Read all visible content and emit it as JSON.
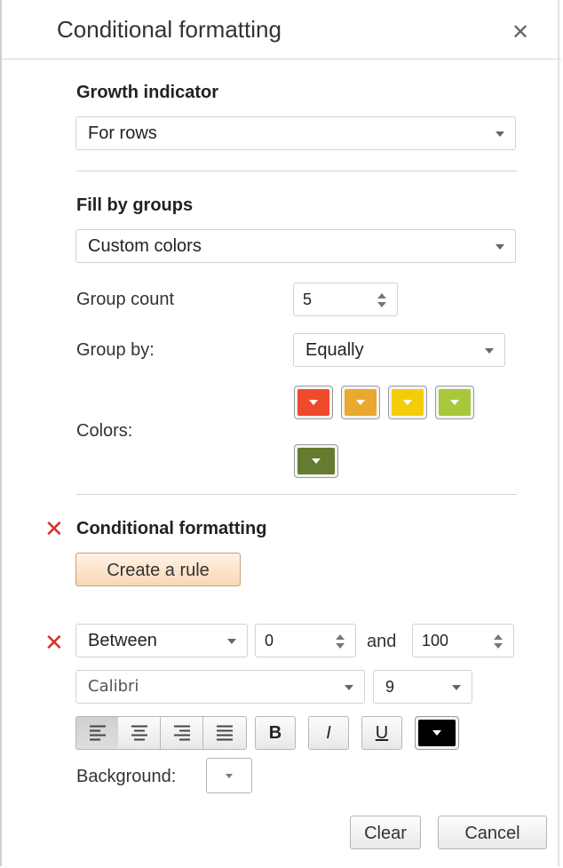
{
  "header": {
    "title": "Conditional formatting"
  },
  "growth": {
    "title": "Growth indicator",
    "select_value": "For rows"
  },
  "fill_groups": {
    "title": "Fill by groups",
    "select_value": "Custom colors",
    "group_count_label": "Group count",
    "group_count_value": "5",
    "group_by_label": "Group by:",
    "group_by_value": "Equally",
    "colors_label": "Colors:",
    "colors": [
      "#f04a2c",
      "#e9a92e",
      "#f4cd09",
      "#a8c83a",
      "#657b2f"
    ]
  },
  "conditional": {
    "title": "Conditional formatting",
    "create_rule_label": "Create a rule"
  },
  "rule": {
    "condition": "Between",
    "from_value": "0",
    "and_label": "and",
    "to_value": "100",
    "font": "Calibri",
    "font_size": "9",
    "bold_label": "B",
    "italic_label": "I",
    "underline_label": "U",
    "font_color": "#000000",
    "background_label": "Background:"
  },
  "footer": {
    "clear_label": "Clear",
    "cancel_label": "Cancel"
  },
  "accent": {
    "delete_x": "#d8312a",
    "rule_button": "#f8d7b4"
  }
}
